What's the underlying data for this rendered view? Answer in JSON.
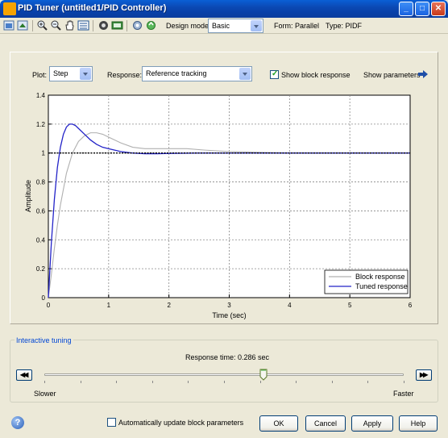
{
  "window": {
    "title": "PID Tuner (untitled1/PID Controller)",
    "min_glyph": "_",
    "max_glyph": "□",
    "close_glyph": "✕"
  },
  "toolbar": {
    "design_mode_label": "Design mode:",
    "design_mode_value": "Basic",
    "form_label": "Form: Parallel",
    "type_label": "Type: PIDF",
    "icons": [
      "import-icon",
      "export-icon",
      "zoom-in-icon",
      "zoom-out-icon",
      "pan-icon",
      "data-cursor-icon",
      "design-icon",
      "block-icon",
      "settings-icon",
      "refresh-icon"
    ]
  },
  "controls": {
    "plot_label": "Plot:",
    "plot_value": "Step",
    "response_label": "Response:",
    "response_value": "Reference tracking",
    "show_block_response_label": "Show block response",
    "show_block_response_checked": true,
    "show_parameters_label": "Show parameters"
  },
  "chart_data": {
    "type": "line",
    "xlabel": "Time (sec)",
    "ylabel": "Amplitude",
    "xlim": [
      0,
      6
    ],
    "ylim": [
      0,
      1.4
    ],
    "xticks": [
      0,
      1,
      2,
      3,
      4,
      5,
      6
    ],
    "yticks": [
      0,
      0.2,
      0.4,
      0.6,
      0.8,
      1,
      1.2,
      1.4
    ],
    "grid": true,
    "legend_position": "bottom-right",
    "reference": 1,
    "series": [
      {
        "name": "Block response",
        "color": "#b0b0b0",
        "x": [
          0,
          0.05,
          0.1,
          0.15,
          0.2,
          0.3,
          0.4,
          0.5,
          0.6,
          0.7,
          0.8,
          0.9,
          1.0,
          1.2,
          1.4,
          1.6,
          1.8,
          2.0,
          2.3,
          2.6,
          3.0,
          3.5,
          4.0,
          5.0,
          6.0
        ],
        "y": [
          0,
          0.16,
          0.34,
          0.5,
          0.64,
          0.86,
          1.0,
          1.08,
          1.12,
          1.14,
          1.14,
          1.13,
          1.11,
          1.07,
          1.04,
          1.03,
          1.03,
          1.03,
          1.03,
          1.02,
          1.01,
          1.005,
          1.0,
          1.0,
          1.0
        ]
      },
      {
        "name": "Tuned response",
        "color": "#2323c8",
        "x": [
          0,
          0.05,
          0.1,
          0.15,
          0.2,
          0.25,
          0.3,
          0.35,
          0.4,
          0.45,
          0.5,
          0.6,
          0.7,
          0.8,
          0.9,
          1.0,
          1.2,
          1.4,
          1.6,
          1.8,
          2.0,
          2.5,
          3.0,
          4.0,
          5.0,
          6.0
        ],
        "y": [
          0,
          0.38,
          0.68,
          0.9,
          1.04,
          1.13,
          1.18,
          1.2,
          1.2,
          1.19,
          1.17,
          1.13,
          1.09,
          1.06,
          1.04,
          1.03,
          1.01,
          1.0,
          0.995,
          0.995,
          0.997,
          1.0,
          1.0,
          1.0,
          1.0,
          1.0
        ]
      }
    ]
  },
  "tuning": {
    "panel_title": "Interactive tuning",
    "response_time_label": "Response time: 0.286 sec",
    "slider_value_fraction": 0.61,
    "slower_label": "Slower",
    "faster_label": "Faster"
  },
  "footer": {
    "auto_update_label": "Automatically update block parameters",
    "auto_update_checked": false,
    "ok_label": "OK",
    "cancel_label": "Cancel",
    "apply_label": "Apply",
    "help_label": "Help",
    "help_icon_glyph": "?"
  }
}
